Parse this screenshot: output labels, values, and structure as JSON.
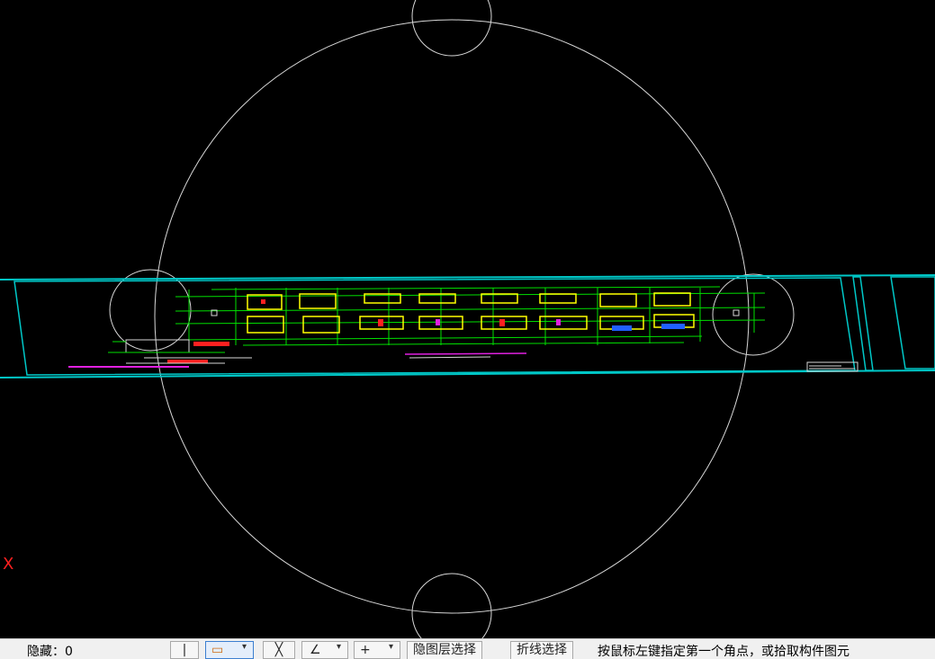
{
  "canvas": {
    "background": "#000000",
    "colors": {
      "circle": "#d8d8d8",
      "frame": "#00c8c8",
      "linework": "#00e000",
      "highlight": "#ffff00",
      "accent_red": "#ff2020",
      "accent_blue": "#2060ff",
      "accent_magenta": "#e020e0"
    },
    "axis_label": "X"
  },
  "statusbar": {
    "hidden_label": "隐藏：0",
    "tools": [
      {
        "icon": "line-tool-icon",
        "glyph": "|"
      },
      {
        "icon": "rect-select-icon",
        "glyph": "▭"
      },
      {
        "icon": "cross-select-icon",
        "glyph": "╳"
      },
      {
        "icon": "angle-tool-icon",
        "glyph": "∠"
      },
      {
        "icon": "plus-tool-icon",
        "glyph": "+"
      }
    ],
    "layer_select_label": "隐图层选择",
    "polyline_select_label": "折线选择",
    "prompt": "按鼠标左键指定第一个角点，或拾取构件图元"
  }
}
